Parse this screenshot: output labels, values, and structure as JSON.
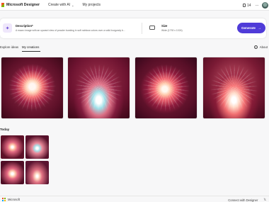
{
  "topbar": {
    "brand": "Microsoft Designer",
    "nav": [
      {
        "label": "Create with AI",
        "has_dropdown": true
      },
      {
        "label": "My projects",
        "has_dropdown": false
      }
    ],
    "credits": "14",
    "more_icon": "ellipsis-icon"
  },
  "prompt": {
    "description_title": "Description*",
    "description_text": "A macro image with an upward view of powder bursting in soft rainbow colors over a solid burgundy b...",
    "size_title": "Size",
    "size_text": "Wide (1792 x 1024)",
    "generate_label": "Generate"
  },
  "tabs": {
    "explore": "Explore ideas",
    "mine": "My creations",
    "about": "About"
  },
  "sections": {
    "today": "Today"
  },
  "footer": {
    "brand": "Microsoft",
    "link": "Connect with Designer"
  },
  "colors": {
    "accent": "#4f3bd8",
    "burgundy": "#5c1028"
  }
}
